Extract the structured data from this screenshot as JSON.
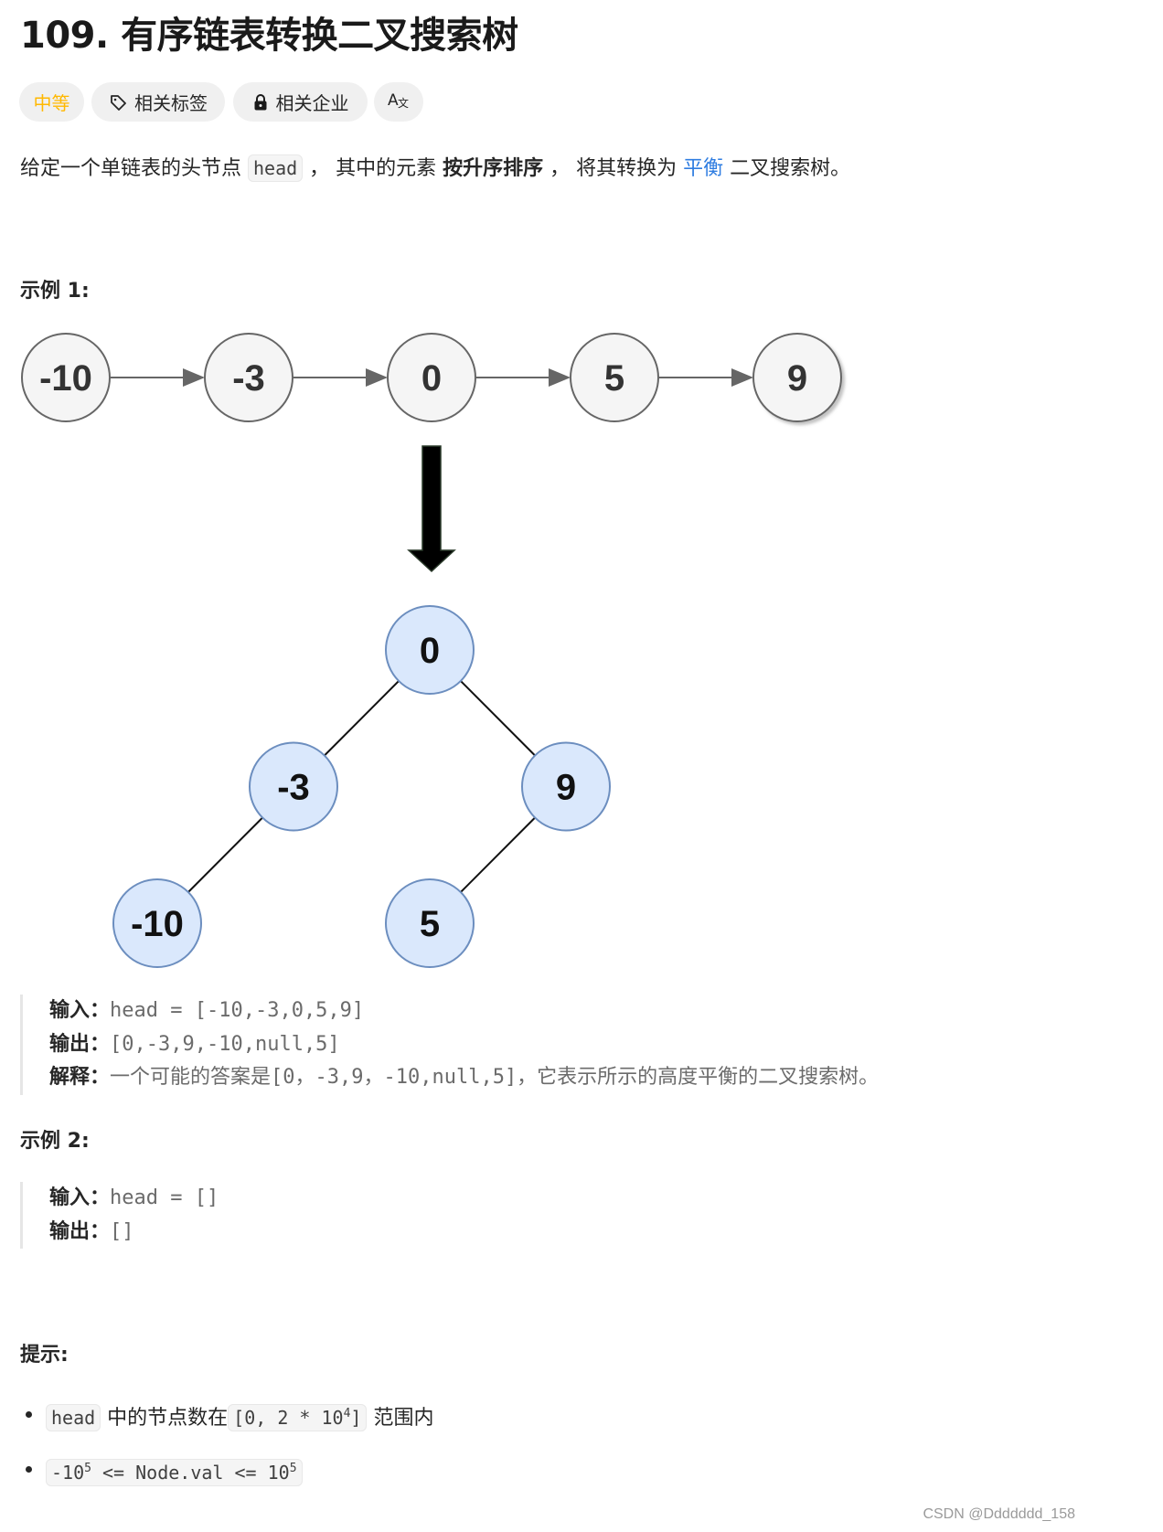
{
  "title": "109. 有序链表转换二叉搜索树",
  "tags": {
    "difficulty": "中等",
    "difficulty_color": "#ffb800",
    "topics_label": "相关标签",
    "topics_icon": "tag-icon",
    "companies_label": "相关企业",
    "companies_icon": "lock-icon",
    "translate_label": "Aあ",
    "translate_icon": "translate-icon"
  },
  "description": {
    "part1": "给定一个单链表的头节点 ",
    "code1": "head",
    "part2": " ， 其中的元素 ",
    "bold1": "按升序排序",
    "part3": " ， 将其转换为 ",
    "link1": "平衡",
    "part4": " 二叉搜索树。",
    "link_color": "#2f7de1"
  },
  "example1": {
    "heading": "示例 1:",
    "linked_list": [
      "-10",
      "-3",
      "0",
      "5",
      "9"
    ],
    "tree": {
      "nodes": [
        {
          "id": "root",
          "value": "0",
          "level": 0,
          "col": 2
        },
        {
          "id": "left",
          "value": "-3",
          "level": 1,
          "col": 1
        },
        {
          "id": "right",
          "value": "9",
          "level": 1,
          "col": 3
        },
        {
          "id": "left-left",
          "value": "-10",
          "level": 2,
          "col": 0
        },
        {
          "id": "right-left",
          "value": "5",
          "level": 2,
          "col": 2
        }
      ],
      "edges": [
        [
          "root",
          "left"
        ],
        [
          "root",
          "right"
        ],
        [
          "left",
          "left-left"
        ],
        [
          "right",
          "right-left"
        ]
      ]
    },
    "input_label": "输入：",
    "input_value": "head = [-10,-3,0,5,9]",
    "output_label": "输出：",
    "output_value": "[0,-3,9,-10,null,5]",
    "explain_label": "解释：",
    "explain_value": "一个可能的答案是[0，-3,9，-10,null,5]，它表示所示的高度平衡的二叉搜索树。"
  },
  "example2": {
    "heading": "示例 2:",
    "input_label": "输入：",
    "input_value": "head = []",
    "output_label": "输出：",
    "output_value": "[]"
  },
  "hints": {
    "heading": "提示:",
    "items": [
      {
        "code": "head",
        "text_mid": " 中的节点数在",
        "code2_base": "[0, 2 * 10",
        "code2_sup": "4",
        "code2_end": "]",
        "text_end": " 范围内"
      },
      {
        "code_a": "-10",
        "sup_a": "5",
        "code_b": " <= Node.val <= 10",
        "sup_b": "5"
      }
    ]
  },
  "watermark": "CSDN @Ddddddd_158"
}
